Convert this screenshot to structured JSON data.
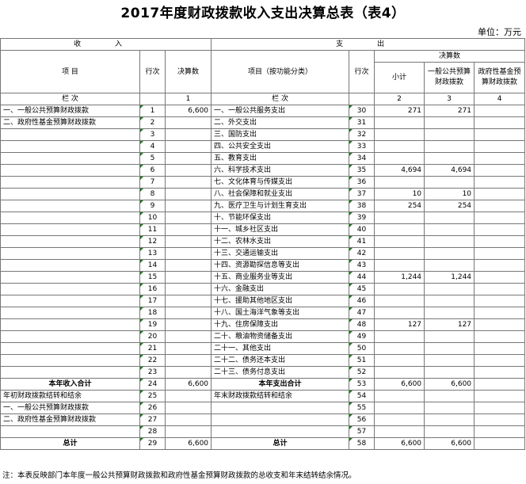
{
  "title": "2017年度财政拨款收入支出决算总表（表4）",
  "unit": "单位：万元",
  "header": {
    "income": "收    入",
    "expense": "支    出",
    "item": "项    目",
    "line_no": "行次",
    "final_amount": "决算数",
    "expense_item": "项目（按功能分类）",
    "final_amount_group": "决算数",
    "subtotal": "小计",
    "general_budget": "一般公共预算财政拨款",
    "gov_fund": "政府性基金预算财政拨款",
    "col_row_label_left": "栏    次",
    "col_row_label_right": "栏    次",
    "col1": "1",
    "col2": "2",
    "col3": "3",
    "col4": "4"
  },
  "rows": [
    {
      "li": "一、一般公共预算财政拨款",
      "ln": "1",
      "la": "6,600",
      "ri": "一、一般公共服务支出",
      "rn": "30",
      "sub": "271",
      "gen": "271",
      "fund": ""
    },
    {
      "li": "二、政府性基金预算财政拨款",
      "ln": "2",
      "la": "",
      "ri": "二、外交支出",
      "rn": "31",
      "sub": "",
      "gen": "",
      "fund": ""
    },
    {
      "li": "",
      "ln": "3",
      "la": "",
      "ri": "三、国防支出",
      "rn": "32",
      "sub": "",
      "gen": "",
      "fund": ""
    },
    {
      "li": "",
      "ln": "4",
      "la": "",
      "ri": "四、公共安全支出",
      "rn": "33",
      "sub": "",
      "gen": "",
      "fund": ""
    },
    {
      "li": "",
      "ln": "5",
      "la": "",
      "ri": "五、教育支出",
      "rn": "34",
      "sub": "",
      "gen": "",
      "fund": ""
    },
    {
      "li": "",
      "ln": "6",
      "la": "",
      "ri": "六、科学技术支出",
      "rn": "35",
      "sub": "4,694",
      "gen": "4,694",
      "fund": ""
    },
    {
      "li": "",
      "ln": "7",
      "la": "",
      "ri": "七、文化体育与传媒支出",
      "rn": "36",
      "sub": "",
      "gen": "",
      "fund": ""
    },
    {
      "li": "",
      "ln": "8",
      "la": "",
      "ri": "八、社会保障和就业支出",
      "rn": "37",
      "sub": "10",
      "gen": "10",
      "fund": ""
    },
    {
      "li": "",
      "ln": "9",
      "la": "",
      "ri": "九、医疗卫生与计划生育支出",
      "rn": "38",
      "sub": "254",
      "gen": "254",
      "fund": ""
    },
    {
      "li": "",
      "ln": "10",
      "la": "",
      "ri": "十、节能环保支出",
      "rn": "39",
      "sub": "",
      "gen": "",
      "fund": ""
    },
    {
      "li": "",
      "ln": "11",
      "la": "",
      "ri": "十一、城乡社区支出",
      "rn": "40",
      "sub": "",
      "gen": "",
      "fund": ""
    },
    {
      "li": "",
      "ln": "12",
      "la": "",
      "ri": "十二、农林水支出",
      "rn": "41",
      "sub": "",
      "gen": "",
      "fund": ""
    },
    {
      "li": "",
      "ln": "13",
      "la": "",
      "ri": "十三、交通运输支出",
      "rn": "42",
      "sub": "",
      "gen": "",
      "fund": ""
    },
    {
      "li": "",
      "ln": "14",
      "la": "",
      "ri": "十四、资源勘探信息等支出",
      "rn": "43",
      "sub": "",
      "gen": "",
      "fund": ""
    },
    {
      "li": "",
      "ln": "15",
      "la": "",
      "ri": "十五、商业服务业等支出",
      "rn": "44",
      "sub": "1,244",
      "gen": "1,244",
      "fund": ""
    },
    {
      "li": "",
      "ln": "16",
      "la": "",
      "ri": "十六、金融支出",
      "rn": "45",
      "sub": "",
      "gen": "",
      "fund": ""
    },
    {
      "li": "",
      "ln": "17",
      "la": "",
      "ri": "十七、援助其他地区支出",
      "rn": "46",
      "sub": "",
      "gen": "",
      "fund": ""
    },
    {
      "li": "",
      "ln": "18",
      "la": "",
      "ri": "十八、国土海洋气象等支出",
      "rn": "47",
      "sub": "",
      "gen": "",
      "fund": ""
    },
    {
      "li": "",
      "ln": "19",
      "la": "",
      "ri": "十九、住房保障支出",
      "rn": "48",
      "sub": "127",
      "gen": "127",
      "fund": ""
    },
    {
      "li": "",
      "ln": "20",
      "la": "",
      "ri": "二十、粮油物资储备支出",
      "rn": "49",
      "sub": "",
      "gen": "",
      "fund": ""
    },
    {
      "li": "",
      "ln": "21",
      "la": "",
      "ri": "二十一、其他支出",
      "rn": "50",
      "sub": "",
      "gen": "",
      "fund": ""
    },
    {
      "li": "",
      "ln": "22",
      "la": "",
      "ri": "二十二、债务还本支出",
      "rn": "51",
      "sub": "",
      "gen": "",
      "fund": ""
    },
    {
      "li": "",
      "ln": "23",
      "la": "",
      "ri": "二十三、债务付息支出",
      "rn": "52",
      "sub": "",
      "gen": "",
      "fund": ""
    },
    {
      "li": "本年收入合计",
      "ln": "24",
      "la": "6,600",
      "ri": "本年支出合计",
      "rn": "53",
      "sub": "6,600",
      "gen": "6,600",
      "fund": "",
      "bold": true
    },
    {
      "li": "年初财政拨款结转和结余",
      "ln": "25",
      "la": "",
      "ri": "年末财政拨款结转和结余",
      "rn": "54",
      "sub": "",
      "gen": "",
      "fund": ""
    },
    {
      "li": "一、一般公共预算财政拨款",
      "ln": "26",
      "la": "",
      "ri": "",
      "rn": "55",
      "sub": "",
      "gen": "",
      "fund": ""
    },
    {
      "li": "二、政府性基金预算财政拨款",
      "ln": "27",
      "la": "",
      "ri": "",
      "rn": "56",
      "sub": "",
      "gen": "",
      "fund": ""
    },
    {
      "li": "",
      "ln": "28",
      "la": "",
      "ri": "",
      "rn": "57",
      "sub": "",
      "gen": "",
      "fund": ""
    },
    {
      "li": "总计",
      "ln": "29",
      "la": "6,600",
      "ri": "总计",
      "rn": "58",
      "sub": "6,600",
      "gen": "6,600",
      "fund": "",
      "bold": true
    }
  ],
  "note": "注：本表反映部门本年度一般公共预算财政拨款和政府性基金预算财政拨款的总收支和年末结转结余情况。"
}
